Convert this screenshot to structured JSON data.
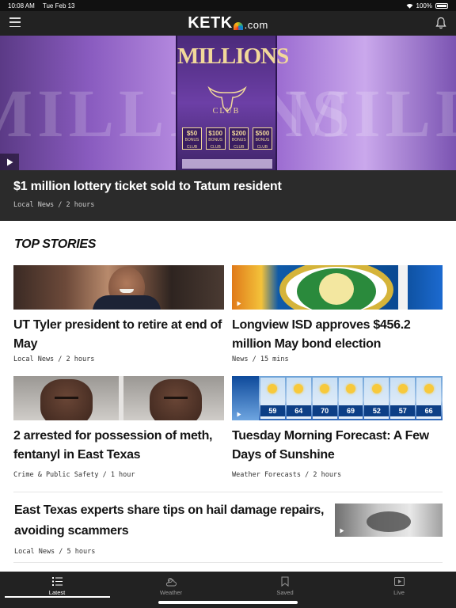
{
  "status_bar": {
    "time": "10:08 AM",
    "date": "Tue Feb 13",
    "battery": "100%"
  },
  "header": {
    "logo_text": "KETK",
    "logo_suffix": ".com",
    "menu_icon": "hamburger-menu-icon",
    "bell_icon": "bell-icon"
  },
  "hero": {
    "ticket_title": "MILLIONS",
    "ticket_subtitle": "CLUB",
    "ticket_prizes": [
      {
        "amount": "$50",
        "label": "BONUS CLUB"
      },
      {
        "amount": "$100",
        "label": "BONUS CLUB"
      },
      {
        "amount": "$200",
        "label": "BONUS CLUB"
      },
      {
        "amount": "$500",
        "label": "BONUS CLUB"
      }
    ],
    "headline": "$1 million lottery ticket sold to Tatum resident",
    "meta": "Local News / 2 hours",
    "play_icon": "play-icon"
  },
  "top_stories": {
    "title": "TOP STORIES",
    "cards": [
      {
        "headline": "UT Tyler president to retire at end of May",
        "meta": "Local News / 2 hours"
      },
      {
        "headline": "Longview ISD approves $456.2 million May bond election",
        "meta": "News / 15 mins"
      },
      {
        "headline": "2 arrested for possession of meth, fentanyl in East Texas",
        "meta": "Crime & Public Safety / 1 hour"
      },
      {
        "headline": "Tuesday Morning Forecast: A Few Days of Sunshine",
        "meta": "Weather Forecasts / 2 hours"
      }
    ],
    "weather_temps": [
      "59",
      "64",
      "70",
      "69",
      "52",
      "57",
      "66"
    ],
    "wide_story": {
      "headline": "East Texas experts share tips on hail damage repairs, avoiding scammers",
      "meta": "Local News / 5 hours"
    }
  },
  "tab_bar": {
    "tabs": [
      {
        "label": "Latest",
        "icon": "list-icon",
        "active": true
      },
      {
        "label": "Weather",
        "icon": "weather-icon",
        "active": false
      },
      {
        "label": "Saved",
        "icon": "bookmark-icon",
        "active": false
      },
      {
        "label": "Live",
        "icon": "live-video-icon",
        "active": false
      }
    ]
  },
  "colors": {
    "header_bg": "#222222",
    "caption_bg": "#2b2b2b",
    "active_tab": "#ffffff",
    "inactive_tab": "#9a9a9a"
  }
}
